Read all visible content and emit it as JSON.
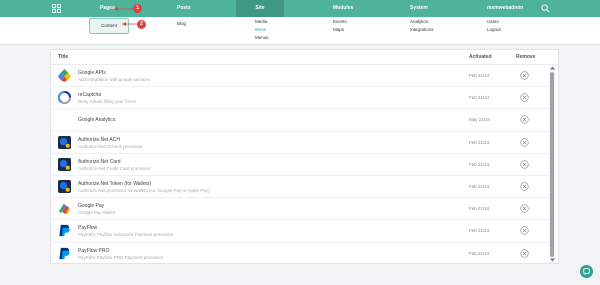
{
  "nav": {
    "items": [
      {
        "label": "Pages"
      },
      {
        "label": "Posts"
      },
      {
        "label": "Site"
      },
      {
        "label": "Modules"
      },
      {
        "label": "System"
      },
      {
        "label": "msmwebadmin"
      }
    ]
  },
  "submenu": {
    "content": "Content",
    "blog": "Blog",
    "media": "Media",
    "items": "Items",
    "menus": "Menus",
    "events": "Events",
    "maps": "Maps",
    "analytics": "Analytics",
    "integrations": "Integrations",
    "users": "Users",
    "logout": "Logout"
  },
  "markers": {
    "one": "1",
    "two": "2"
  },
  "table": {
    "headers": {
      "title": "Title",
      "activated": "Activated",
      "remove": "Remove"
    },
    "rows": [
      {
        "name": "Google APIs",
        "desc": "Add integration with google services",
        "date": "Feb 21/24",
        "icon": "google-apis-icon"
      },
      {
        "name": "reCaptcha",
        "desc": "Deny robots filling your forms",
        "date": "Feb 21/24",
        "icon": "recaptcha-icon"
      },
      {
        "name": "Google Analytics",
        "desc": "",
        "date": "May 21/24",
        "icon": "none"
      },
      {
        "name": "Authorize.Net ACH",
        "desc": "Authorize.Net eCheck processor",
        "date": "Feb 21/24",
        "icon": "authorize-net-icon"
      },
      {
        "name": "Authorize.Net Card",
        "desc": "Authorize.Net Credit Card processor",
        "date": "Feb 21/24",
        "icon": "authorize-net-icon"
      },
      {
        "name": "Authorize.Net Token (for Wallets)",
        "desc": "Authorize.Net processor for wallets (i.e. Google Pay or Apple Pay)",
        "date": "Feb 21/24",
        "icon": "authorize-net-icon"
      },
      {
        "name": "Google Pay",
        "desc": "Google Pay Wallet",
        "date": "Feb 21/24",
        "icon": "google-pay-icon"
      },
      {
        "name": "PayFlow",
        "desc": "PayPal's Payflow Advanced Payment processor",
        "date": "Feb 21/24",
        "icon": "paypal-icon"
      },
      {
        "name": "PayFlow PRO",
        "desc": "PayPal's Payflow PRO Payment processor",
        "date": "Feb 21/24",
        "icon": "paypal-icon"
      }
    ]
  },
  "colors": {
    "brand": "#4fb29b",
    "brand_dark": "#3f9884",
    "marker": "#e04040"
  }
}
